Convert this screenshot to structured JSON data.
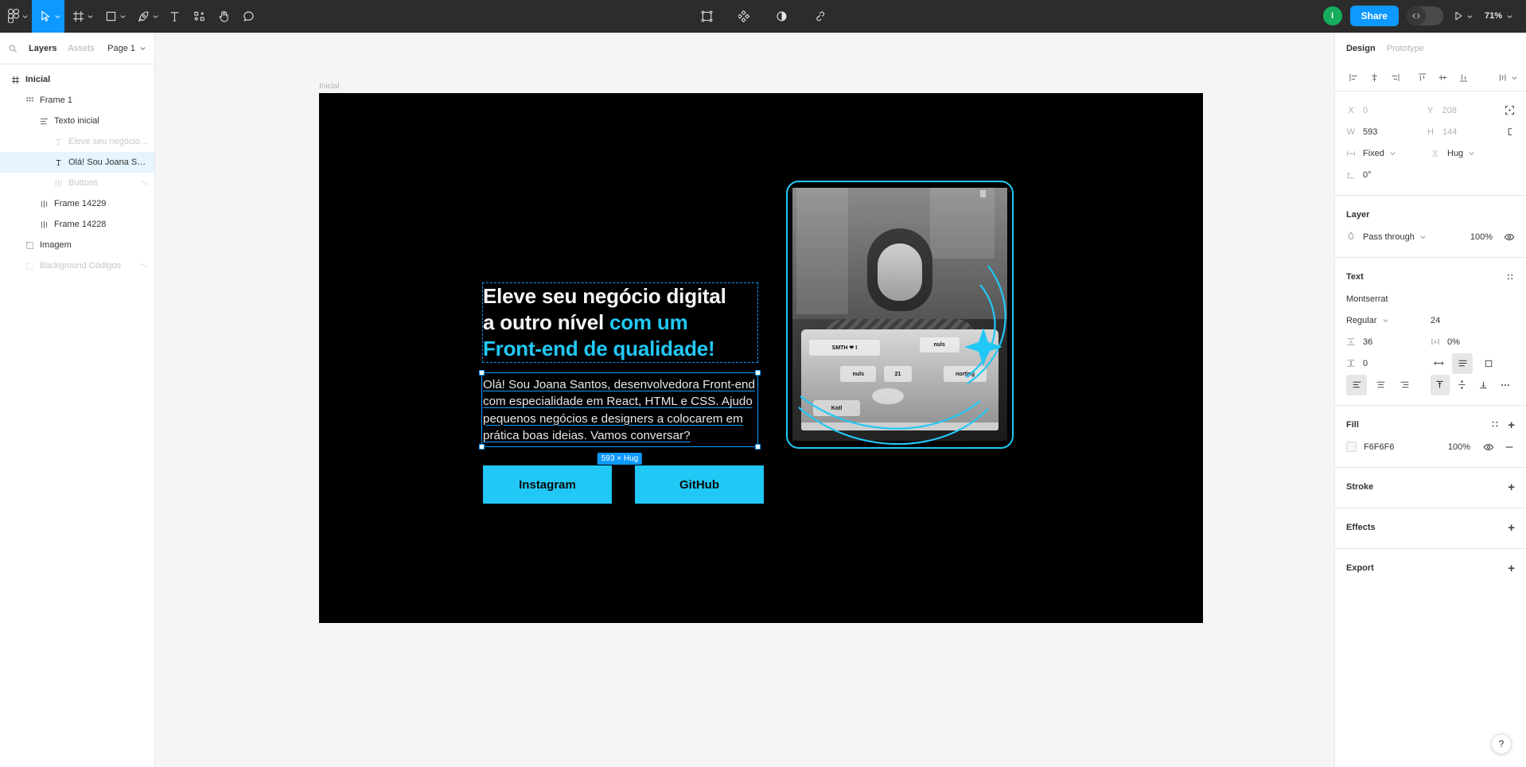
{
  "toolbar": {
    "left_tools": [
      {
        "name": "figma-menu-icon",
        "label": "Figma menu",
        "has_caret": true,
        "active": false
      },
      {
        "name": "move-tool-icon",
        "label": "Move",
        "has_caret": true,
        "active": true
      },
      {
        "name": "frame-tool-icon",
        "label": "Frame",
        "has_caret": true,
        "active": false
      },
      {
        "name": "shape-tool-icon",
        "label": "Shape",
        "has_caret": true,
        "active": false
      },
      {
        "name": "pen-tool-icon",
        "label": "Pen",
        "has_caret": true,
        "active": false
      },
      {
        "name": "text-tool-icon",
        "label": "Text",
        "has_caret": false,
        "active": false
      },
      {
        "name": "actions-tool-icon",
        "label": "Actions",
        "has_caret": false,
        "active": false
      },
      {
        "name": "hand-tool-icon",
        "label": "Hand",
        "has_caret": false,
        "active": false
      },
      {
        "name": "comment-tool-icon",
        "label": "Comment",
        "has_caret": false,
        "active": false
      }
    ],
    "center_tools": [
      {
        "name": "component-icon",
        "label": "Create component"
      },
      {
        "name": "plugins-icon",
        "label": "Plugins"
      },
      {
        "name": "contrast-icon",
        "label": "Contrast"
      },
      {
        "name": "link-icon",
        "label": "Link"
      }
    ],
    "avatar_initial": "I",
    "share_label": "Share",
    "devmode_label": "</>",
    "present_label": "Present",
    "zoom_label": "71%"
  },
  "left_panel": {
    "tabs": [
      {
        "label": "Layers",
        "active": true
      },
      {
        "label": "Assets",
        "active": false
      }
    ],
    "page_selector": "Page 1",
    "search_icon": "search-icon",
    "layers": [
      {
        "name": "Inicial",
        "icon": "page-frame-icon",
        "depth": 0,
        "selected": false,
        "dim": false,
        "bold": true,
        "mask": false
      },
      {
        "name": "Frame 1",
        "icon": "grid-layout-icon",
        "depth": 1,
        "selected": false,
        "dim": false,
        "bold": false,
        "mask": false
      },
      {
        "name": "Texto inicial",
        "icon": "vertical-autolayout-icon",
        "depth": 2,
        "selected": false,
        "dim": false,
        "bold": false,
        "mask": false
      },
      {
        "name": "Eleve seu negócio di...",
        "icon": "text-layer-icon",
        "depth": 3,
        "selected": false,
        "dim": true,
        "bold": false,
        "mask": false
      },
      {
        "name": "Olá! Sou Joana Sant...",
        "icon": "text-layer-icon",
        "depth": 3,
        "selected": true,
        "dim": false,
        "bold": false,
        "mask": false
      },
      {
        "name": "Buttons",
        "icon": "horizontal-autolayout-icon",
        "depth": 3,
        "selected": false,
        "dim": true,
        "bold": false,
        "mask": true
      },
      {
        "name": "Frame 14229",
        "icon": "horizontal-autolayout-icon",
        "depth": 2,
        "selected": false,
        "dim": false,
        "bold": false,
        "mask": false
      },
      {
        "name": "Frame 14228",
        "icon": "horizontal-autolayout-icon",
        "depth": 2,
        "selected": false,
        "dim": false,
        "bold": false,
        "mask": false
      },
      {
        "name": "Imagem",
        "icon": "group-icon",
        "depth": 1,
        "selected": false,
        "dim": false,
        "bold": false,
        "mask": false
      },
      {
        "name": "Background Códigos",
        "icon": "group-icon",
        "depth": 1,
        "selected": false,
        "dim": true,
        "bold": false,
        "mask": true
      }
    ]
  },
  "canvas": {
    "frame_name": "Inicial",
    "headline": {
      "line1": "Eleve seu negócio digital",
      "line2_plain": "a outro nível ",
      "line2_accent": "com um",
      "line3_accent": "Front-end de qualidade!"
    },
    "paragraph": "Olá! Sou Joana Santos, desenvolvedora Front-end com especialidade em React, HTML e CSS. Ajudo pequenos negócios e designers a colocarem em prática boas ideias. Vamos conversar?",
    "size_badge": "593 × Hug",
    "buttons": [
      {
        "label": "Instagram"
      },
      {
        "label": "GitHub"
      }
    ],
    "colors": {
      "accent": "#22c8f5",
      "selection": "#0d99ff",
      "background": "#000000",
      "text": "#f6f6f6"
    },
    "laptop_stickers": [
      "SMTH ❤ I",
      "nuls",
      "21",
      "nuls",
      "nortipg",
      "Kotl"
    ]
  },
  "right_panel": {
    "tabs": [
      {
        "label": "Design",
        "active": true
      },
      {
        "label": "Prototype",
        "active": false
      }
    ],
    "align_buttons": [
      "align-left-icon",
      "align-horizontal-center-icon",
      "align-right-icon",
      "align-top-icon",
      "align-vertical-center-icon",
      "align-bottom-icon",
      "distribute-icon"
    ],
    "position": {
      "x_label": "X",
      "x_value": "0",
      "y_label": "Y",
      "y_value": "208",
      "w_label": "W",
      "w_value": "593",
      "h_label": "H",
      "h_value": "144",
      "horizontal_resizing": "Fixed",
      "vertical_resizing": "Hug",
      "rotation": "0°"
    },
    "layer": {
      "title": "Layer",
      "blend_mode": "Pass through",
      "opacity": "100%"
    },
    "text": {
      "title": "Text",
      "font_family": "Montserrat",
      "font_weight": "Regular",
      "font_size": "24",
      "line_height": "36",
      "letter_spacing": "0%",
      "paragraph_spacing": "0",
      "align_horizontal": "left",
      "align_vertical": "top"
    },
    "fill": {
      "title": "Fill",
      "color": "F6F6F6",
      "opacity": "100%"
    },
    "stroke": {
      "title": "Stroke"
    },
    "effects": {
      "title": "Effects"
    },
    "export": {
      "title": "Export"
    },
    "help_label": "?"
  }
}
